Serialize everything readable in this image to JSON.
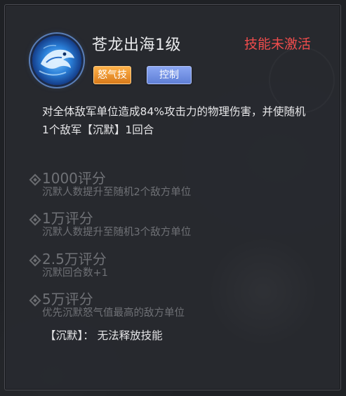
{
  "skill": {
    "name": "苍龙出海1级",
    "status": "技能未激活",
    "icon": "blue-dragon-icon",
    "tags": [
      "怒气技",
      "控制"
    ],
    "description": "对全体敌军单位造成84%攻击力的物理伤害，并使随机1个敌军【沉默】1回合"
  },
  "tiers": [
    {
      "title": "1000评分",
      "desc": "沉默人数提升至随机2个敌方单位"
    },
    {
      "title": "1万评分",
      "desc": "沉默人数提升至随机3个敌方单位"
    },
    {
      "title": "2.5万评分",
      "desc": "沉默回合数+1"
    },
    {
      "title": "5万评分",
      "desc": "优先沉默怒气值最高的敌方单位"
    }
  ],
  "note": "【沉默】： 无法释放技能",
  "colors": {
    "status_inactive": "#ee4c4c",
    "tag_rage": "#f0a13a",
    "tag_control": "#7b96e6",
    "tier_locked_text": "#6f7176"
  }
}
